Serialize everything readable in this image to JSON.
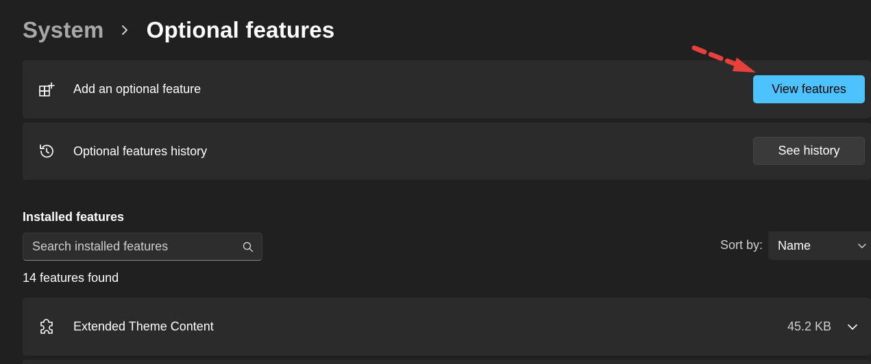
{
  "breadcrumb": {
    "parent": "System",
    "current": "Optional features"
  },
  "cards": {
    "add": {
      "label": "Add an optional feature",
      "button": "View features",
      "icon": "add-apps-icon"
    },
    "history": {
      "label": "Optional features history",
      "button": "See history",
      "icon": "history-icon"
    }
  },
  "installed": {
    "title": "Installed features",
    "search_placeholder": "Search installed features",
    "sort_label": "Sort by:",
    "sort_value": "Name",
    "count_text": "14 features found",
    "items": [
      {
        "name": "Extended Theme Content",
        "size": "45.2 KB",
        "icon": "puzzle-icon"
      }
    ]
  },
  "colors": {
    "accent": "#4cc2ff",
    "background": "#202020",
    "card": "#2b2b2b",
    "annotation": "#e8413c"
  }
}
